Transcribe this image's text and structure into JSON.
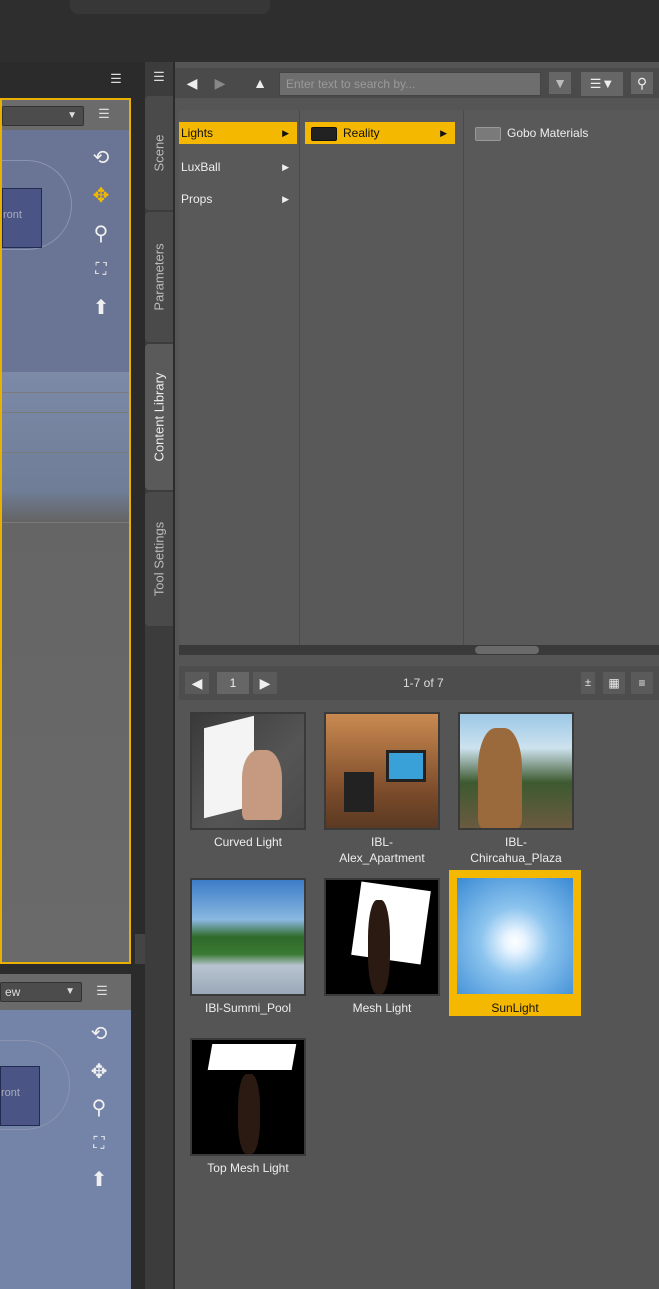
{
  "viewport_top": {
    "view_select": "",
    "front_label": "ront"
  },
  "viewport_bottom": {
    "view_select": "ew",
    "front_label": "ront"
  },
  "tabs": [
    {
      "label": "Scene"
    },
    {
      "label": "Parameters"
    },
    {
      "label": "Content Library"
    },
    {
      "label": "Tool Settings"
    }
  ],
  "content_library": {
    "search_placeholder": "Enter text to search by...",
    "column1": [
      {
        "label": "Lights",
        "selected": true
      },
      {
        "label": "LuxBall",
        "selected": false
      },
      {
        "label": "Props",
        "selected": false
      }
    ],
    "column2": [
      {
        "label": "Reality",
        "selected": true
      }
    ],
    "column3": [
      {
        "label": "Gobo Materials",
        "selected": false
      }
    ],
    "pager": {
      "page": "1",
      "count": "1-7 of 7"
    },
    "items": [
      {
        "label": "Curved Light",
        "selected": false
      },
      {
        "label": "IBL-\nAlex_Apartment",
        "selected": false
      },
      {
        "label": "IBL-\nChircahua_Plaza",
        "selected": false
      },
      {
        "label": "IBl-Summi_Pool",
        "selected": false
      },
      {
        "label": "Mesh Light",
        "selected": false
      },
      {
        "label": "SunLight",
        "selected": true
      },
      {
        "label": "Top Mesh Light",
        "selected": false
      }
    ]
  },
  "colors": {
    "accent": "#f5b800",
    "panel": "#555555",
    "viewport": "#6a7595"
  }
}
